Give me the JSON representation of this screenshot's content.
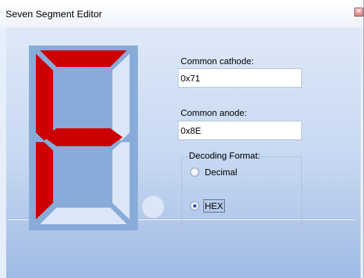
{
  "window": {
    "title": "Seven Segment Editor"
  },
  "fields": {
    "common_cathode_label": "Common cathode:",
    "common_cathode_value": "0x71",
    "common_anode_label": "Common anode:",
    "common_anode_value": "0x8E"
  },
  "decoding": {
    "legend": "Decoding Format:",
    "options": [
      "Decimal",
      "HEX"
    ],
    "selected": "HEX"
  },
  "segments": {
    "a": true,
    "b": false,
    "c": false,
    "d": false,
    "e": true,
    "f": true,
    "g": true,
    "dp": false
  },
  "colors": {
    "segment_on": "#cc0000",
    "segment_off": "#dbe7f8",
    "display_body": "#88abd9",
    "dot": "#dbe7f8"
  },
  "icons": {
    "close": "close-icon"
  }
}
